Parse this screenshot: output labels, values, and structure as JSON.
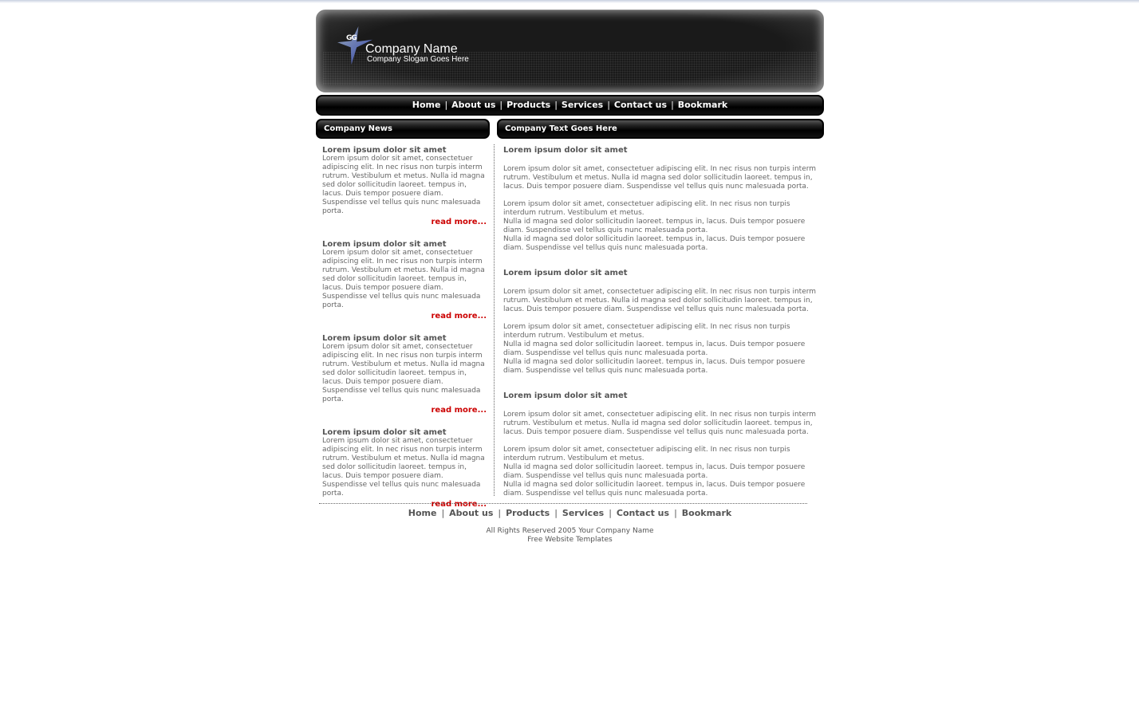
{
  "header": {
    "company_name": "Company Name",
    "slogan": "Company Slogan Goes Here",
    "logo_text": "GG"
  },
  "nav": [
    "Home",
    "About us",
    "Products",
    "Services",
    "Contact us",
    "Bookmark"
  ],
  "left": {
    "title": "Company News",
    "items": [
      {
        "title": "Lorem ipsum dolor sit amet",
        "text": "Lorem ipsum dolor sit amet, consectetuer adipiscing elit. In nec risus non turpis interm rutrum. Vestibulum et metus. Nulla id magna sed dolor sollicitudin laoreet. tempus in, lacus. Duis tempor posuere diam. Suspendisse vel tellus quis nunc malesuada porta.",
        "more": "read more..."
      },
      {
        "title": "Lorem ipsum dolor sit amet",
        "text": "Lorem ipsum dolor sit amet, consectetuer adipiscing elit. In nec risus non turpis interm rutrum. Vestibulum et metus. Nulla id magna sed dolor sollicitudin laoreet. tempus in, lacus. Duis tempor posuere diam. Suspendisse vel tellus quis nunc malesuada porta.",
        "more": "read more..."
      },
      {
        "title": "Lorem ipsum dolor sit amet",
        "text": "Lorem ipsum dolor sit amet, consectetuer adipiscing elit. In nec risus non turpis interm rutrum. Vestibulum et metus. Nulla id magna sed dolor sollicitudin laoreet. tempus in, lacus. Duis tempor posuere diam. Suspendisse vel tellus quis nunc malesuada porta.",
        "more": "read more..."
      },
      {
        "title": "Lorem ipsum dolor sit amet",
        "text": "Lorem ipsum dolor sit amet, consectetuer adipiscing elit. In nec risus non turpis interm rutrum. Vestibulum et metus. Nulla id magna sed dolor sollicitudin laoreet. tempus in, lacus. Duis tempor posuere diam. Suspendisse vel tellus quis nunc malesuada porta.",
        "more": "read more..."
      }
    ]
  },
  "right": {
    "title": "Company Text Goes Here",
    "sections": [
      {
        "title": "Lorem ipsum dolor sit amet",
        "p1": "Lorem ipsum dolor sit amet, consectetuer adipiscing elit. In nec risus non turpis interm rutrum. Vestibulum et metus. Nulla id magna sed dolor sollicitudin laoreet. tempus in, lacus. Duis tempor posuere diam. Suspendisse vel tellus quis nunc malesuada porta.",
        "p2a": "Lorem ipsum dolor sit amet, consectetuer adipiscing elit. In nec risus non turpis interdum rutrum. Vestibulum et metus.",
        "p2b": "Nulla id magna sed dolor sollicitudin laoreet. tempus in, lacus. Duis tempor posuere diam. Suspendisse vel tellus quis nunc malesuada porta.",
        "p2c": "Nulla id magna sed dolor sollicitudin laoreet. tempus in, lacus. Duis tempor posuere diam. Suspendisse vel tellus quis nunc malesuada porta."
      },
      {
        "title": "Lorem ipsum dolor sit amet",
        "p1": "Lorem ipsum dolor sit amet, consectetuer adipiscing elit. In nec risus non turpis interm rutrum. Vestibulum et metus. Nulla id magna sed dolor sollicitudin laoreet. tempus in, lacus. Duis tempor posuere diam. Suspendisse vel tellus quis nunc malesuada porta.",
        "p2a": "Lorem ipsum dolor sit amet, consectetuer adipiscing elit. In nec risus non turpis interdum rutrum. Vestibulum et metus.",
        "p2b": "Nulla id magna sed dolor sollicitudin laoreet. tempus in, lacus. Duis tempor posuere diam. Suspendisse vel tellus quis nunc malesuada porta.",
        "p2c": "Nulla id magna sed dolor sollicitudin laoreet. tempus in, lacus. Duis tempor posuere diam. Suspendisse vel tellus quis nunc malesuada porta."
      },
      {
        "title": "Lorem ipsum dolor sit amet",
        "p1": "Lorem ipsum dolor sit amet, consectetuer adipiscing elit. In nec risus non turpis interm rutrum. Vestibulum et metus. Nulla id magna sed dolor sollicitudin laoreet. tempus in, lacus. Duis tempor posuere diam. Suspendisse vel tellus quis nunc malesuada porta.",
        "p2a": "Lorem ipsum dolor sit amet, consectetuer adipiscing elit. In nec risus non turpis interdum rutrum. Vestibulum et metus.",
        "p2b": "Nulla id magna sed dolor sollicitudin laoreet. tempus in, lacus. Duis tempor posuere diam. Suspendisse vel tellus quis nunc malesuada porta.",
        "p2c": "Nulla id magna sed dolor sollicitudin laoreet. tempus in, lacus. Duis tempor posuere diam. Suspendisse vel tellus quis nunc malesuada porta."
      }
    ]
  },
  "footer": {
    "links": [
      "Home",
      "About us",
      "Products",
      "Services",
      "Contact us",
      "Bookmark"
    ],
    "copyright": "All Rights Reserved 2005 Your Company Name",
    "credit": "Free Website Templates"
  },
  "colors": {
    "accent": "#cc0000",
    "bar": "#000000",
    "text": "#666666"
  }
}
